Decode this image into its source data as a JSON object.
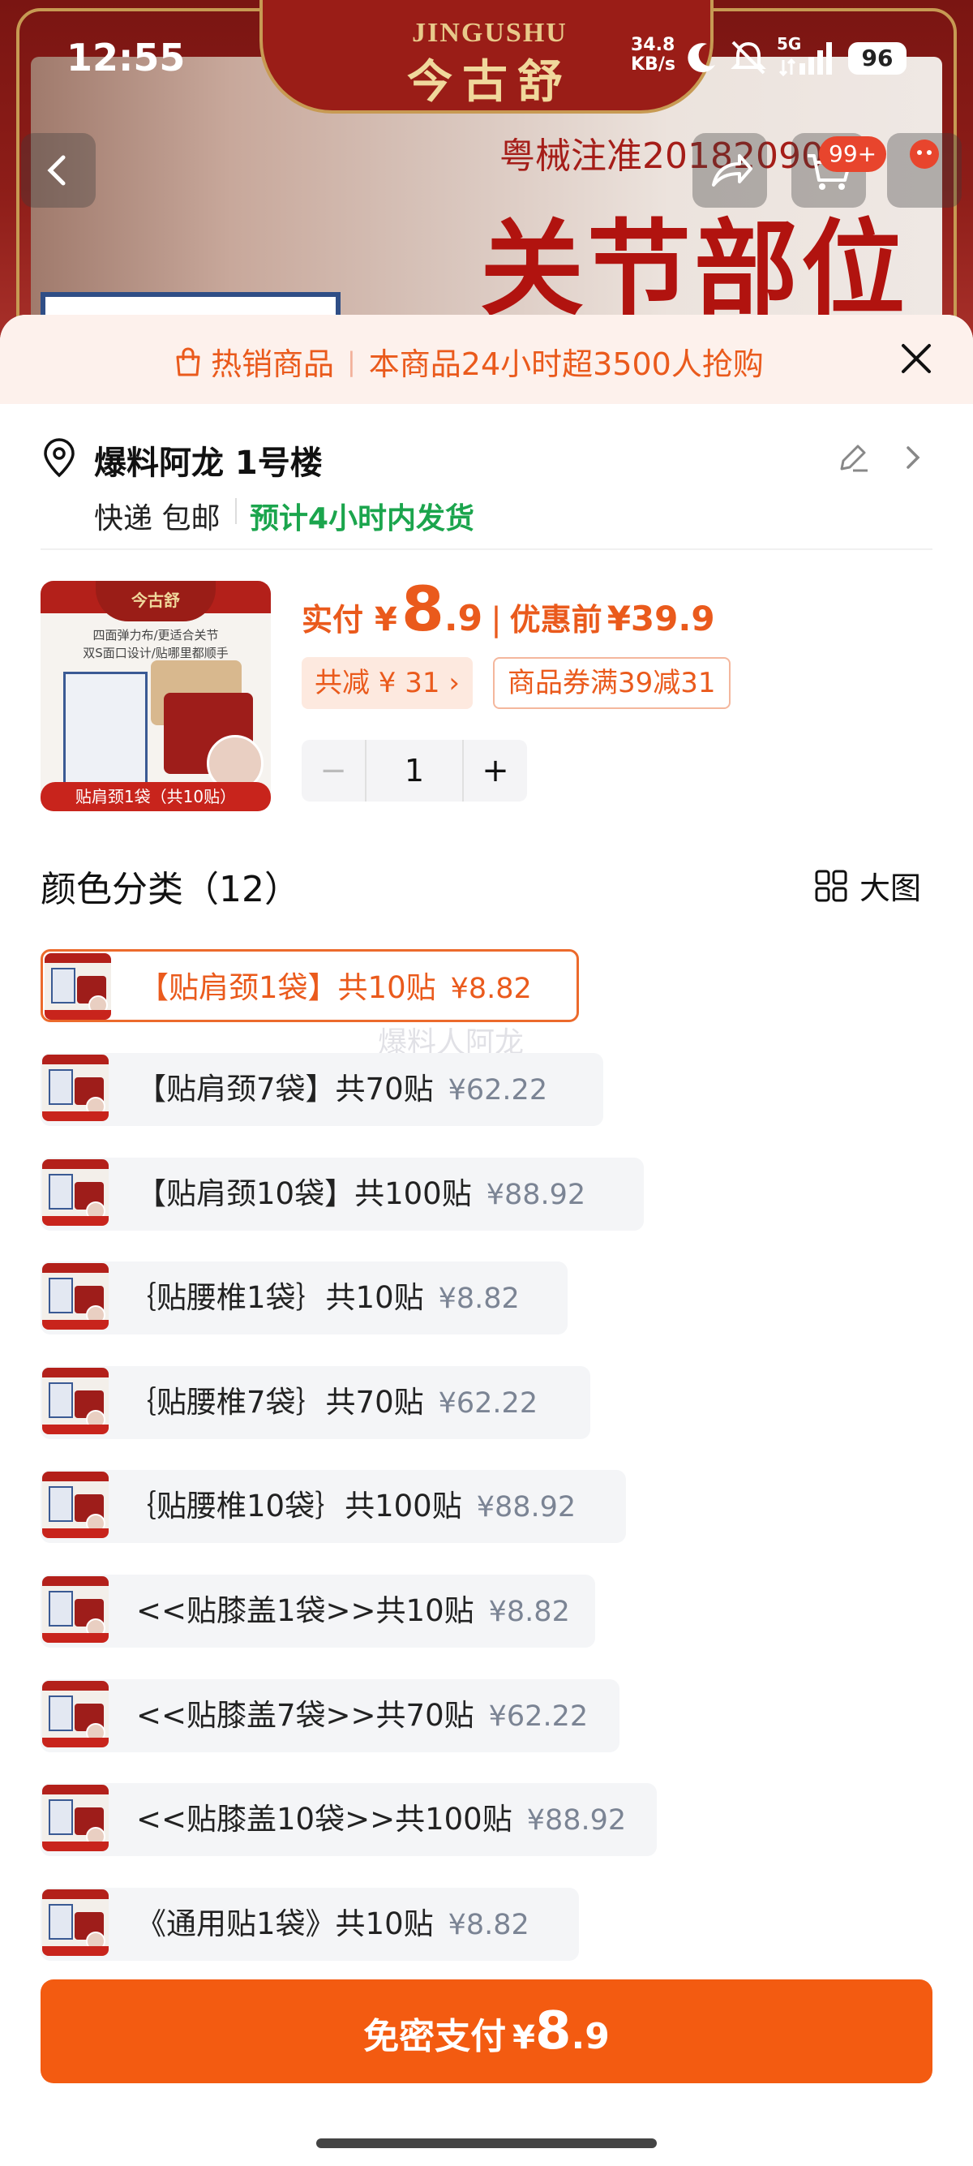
{
  "status_bar": {
    "time": "12:55",
    "net_speed": "34.8",
    "net_unit": "KB/s",
    "network": "5G",
    "battery": "96"
  },
  "banner": {
    "brand_en": "JINGUSHU",
    "brand_cn": "今古舒",
    "cert": "粤械注准20182090",
    "headline": "关节部位",
    "cart_badge": "99+"
  },
  "hot_bar": {
    "tag": "热销商品",
    "text": "本商品24小时超3500人抢购"
  },
  "address": {
    "name": "爆料阿龙 1号楼",
    "shipping": "快递 包邮",
    "eta": "预计4小时内发货"
  },
  "product": {
    "thumb_brand": "今古舒",
    "thumb_line1": "四面弹力布/更适合关节",
    "thumb_line2": "双S面口设计/贴哪里都顺手",
    "thumb_caption": "贴肩颈1袋（共10贴）",
    "pay_label": "实付",
    "currency": "¥",
    "price_int": "8",
    "price_dec": ".9",
    "orig_label": "优惠前",
    "orig_price": "¥39.9",
    "save_label": "共减 ¥ 31 ›",
    "coupon_label": "商品券满39减31",
    "quantity": "1"
  },
  "options_section": {
    "title": "颜色分类（12）",
    "bigview_label": "大图"
  },
  "options": [
    {
      "label": "【贴肩颈1袋】共10贴",
      "price": "¥8.82",
      "selected": true
    },
    {
      "label": "【贴肩颈7袋】共70贴",
      "price": "¥62.22"
    },
    {
      "label": "【贴肩颈10袋】共100贴",
      "price": "¥88.92"
    },
    {
      "label": "｛贴腰椎1袋｝共10贴",
      "price": "¥8.82"
    },
    {
      "label": "｛贴腰椎7袋｝共70贴",
      "price": "¥62.22"
    },
    {
      "label": "｛贴腰椎10袋｝共100贴",
      "price": "¥88.92"
    },
    {
      "label": "<<贴膝盖1袋>>共10贴",
      "price": "¥8.82"
    },
    {
      "label": "<<贴膝盖7袋>>共70贴",
      "price": "¥62.22"
    },
    {
      "label": "<<贴膝盖10袋>>共100贴",
      "price": "¥88.92"
    },
    {
      "label": "《通用贴1袋》共10贴",
      "price": "¥8.82"
    }
  ],
  "watermark": "爆料人阿龙",
  "pay_button": {
    "label": "免密支付",
    "currency": "¥",
    "price_int": "8",
    "price_dec": ".9"
  },
  "colors": {
    "accent": "#ea5a1c",
    "pay_button": "#f35b11",
    "eta_green": "#1ba54d",
    "price_gray": "#7b8494"
  }
}
